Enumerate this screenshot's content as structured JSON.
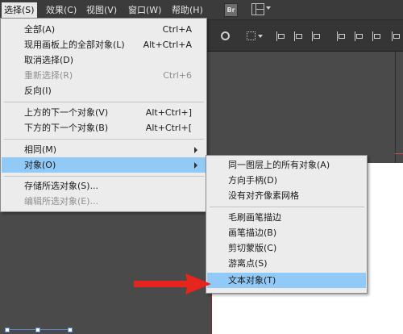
{
  "menubar": {
    "items": [
      "选择(S)",
      "效果(C)",
      "视图(V)",
      "窗口(W)",
      "帮助(H)"
    ],
    "bridge_icon": "Br",
    "workspace_icon": "workspace-layout-icon"
  },
  "select_menu": {
    "items": [
      {
        "label": "全部(A)",
        "shortcut": "Ctrl+A"
      },
      {
        "label": "现用画板上的全部对象(L)",
        "shortcut": "Alt+Ctrl+A"
      },
      {
        "label": "取消选择(D)",
        "shortcut": ""
      },
      {
        "label": "重新选择(R)",
        "shortcut": "Ctrl+6"
      },
      {
        "label": "反向(I)",
        "shortcut": ""
      },
      {
        "label": "上方的下一个对象(V)",
        "shortcut": "Alt+Ctrl+]"
      },
      {
        "label": "下方的下一个对象(B)",
        "shortcut": "Alt+Ctrl+["
      },
      {
        "label": "相同(M)",
        "shortcut": ""
      },
      {
        "label": "对象(O)",
        "shortcut": ""
      },
      {
        "label": "存储所选对象(S)...",
        "shortcut": ""
      },
      {
        "label": "编辑所选对象(E)...",
        "shortcut": ""
      }
    ]
  },
  "object_submenu": {
    "items": [
      {
        "label": "同一图层上的所有对象(A)"
      },
      {
        "label": "方向手柄(D)"
      },
      {
        "label": "没有对齐像素网格"
      },
      {
        "label": "毛刷画笔描边"
      },
      {
        "label": "画笔描边(B)"
      },
      {
        "label": "剪切蒙版(C)"
      },
      {
        "label": "游离点(S)"
      },
      {
        "label": "文本对象(T)"
      }
    ]
  },
  "colors": {
    "highlight": "#91c9f7",
    "menu_bg": "#ececec",
    "annotation_arrow": "#e8241f"
  }
}
